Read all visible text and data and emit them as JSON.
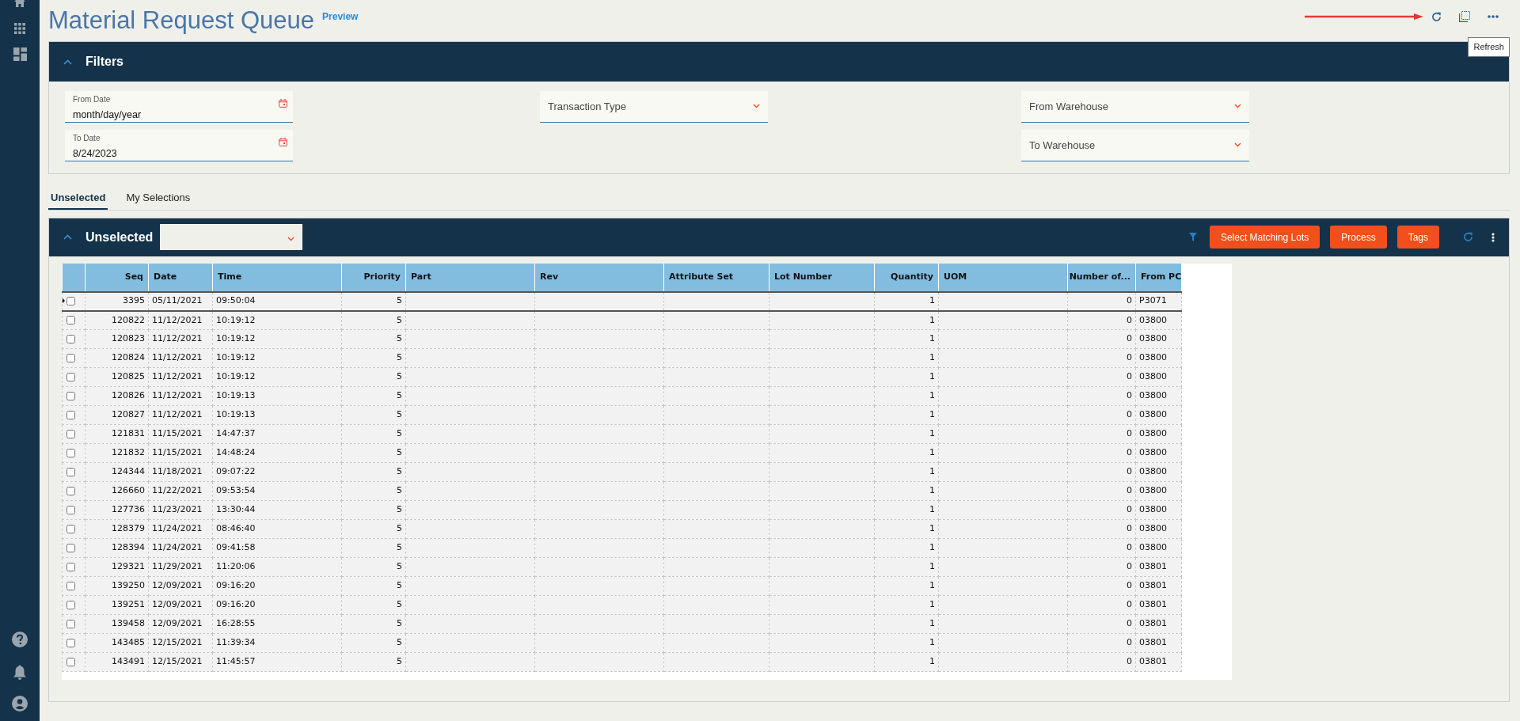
{
  "page": {
    "title": "Material Request Queue",
    "badge": "Preview"
  },
  "toolbar": {
    "tooltip": "Refresh"
  },
  "filters": {
    "title": "Filters",
    "expanded": true,
    "columns": [
      [
        {
          "kind": "date",
          "label": "From Date",
          "placeholder": "month/day/year"
        },
        {
          "kind": "date",
          "label": "To Date",
          "value": "8/24/2023"
        }
      ],
      [
        {
          "kind": "select",
          "placeholder": "Transaction Type"
        }
      ],
      [
        {
          "kind": "select",
          "placeholder": "From Warehouse"
        },
        {
          "kind": "select",
          "placeholder": "To Warehouse"
        }
      ]
    ]
  },
  "tabs": [
    {
      "label": "Unselected",
      "selected": true
    },
    {
      "label": "My Selections",
      "selected": false
    }
  ],
  "grid": {
    "title": "Unselected",
    "expanded": true,
    "buttons": [
      "Select Matching Lots",
      "Process",
      "Tags"
    ],
    "columns": [
      {
        "label": "Seq",
        "numeric": true
      },
      {
        "label": "Date",
        "numeric": false
      },
      {
        "label": "Time",
        "numeric": false
      },
      {
        "label": "Priority",
        "numeric": true
      },
      {
        "label": "Part",
        "numeric": false
      },
      {
        "label": "Rev",
        "numeric": false
      },
      {
        "label": "Attribute Set",
        "numeric": false
      },
      {
        "label": "Lot Number",
        "numeric": false
      },
      {
        "label": "Quantity",
        "numeric": true
      },
      {
        "label": "UOM",
        "numeric": false
      },
      {
        "label": "Number of...",
        "numeric": true
      },
      {
        "label": "From PC",
        "numeric": false
      }
    ],
    "rows": [
      {
        "current": true,
        "checked": false,
        "cells": [
          "3395",
          "05/11/2021",
          "09:50:04",
          "5",
          null,
          null,
          null,
          null,
          "1",
          null,
          "0",
          "P3071"
        ]
      },
      {
        "current": false,
        "checked": false,
        "cells": [
          "120822",
          "11/12/2021",
          "10:19:12",
          "5",
          null,
          null,
          null,
          null,
          "1",
          null,
          "0",
          "03800"
        ]
      },
      {
        "current": false,
        "checked": false,
        "cells": [
          "120823",
          "11/12/2021",
          "10:19:12",
          "5",
          null,
          null,
          null,
          null,
          "1",
          null,
          "0",
          "03800"
        ]
      },
      {
        "current": false,
        "checked": false,
        "cells": [
          "120824",
          "11/12/2021",
          "10:19:12",
          "5",
          null,
          null,
          null,
          null,
          "1",
          null,
          "0",
          "03800"
        ]
      },
      {
        "current": false,
        "checked": false,
        "cells": [
          "120825",
          "11/12/2021",
          "10:19:12",
          "5",
          null,
          null,
          null,
          null,
          "1",
          null,
          "0",
          "03800"
        ]
      },
      {
        "current": false,
        "checked": false,
        "cells": [
          "120826",
          "11/12/2021",
          "10:19:13",
          "5",
          null,
          null,
          null,
          null,
          "1",
          null,
          "0",
          "03800"
        ]
      },
      {
        "current": false,
        "checked": false,
        "cells": [
          "120827",
          "11/12/2021",
          "10:19:13",
          "5",
          null,
          null,
          null,
          null,
          "1",
          null,
          "0",
          "03800"
        ]
      },
      {
        "current": false,
        "checked": false,
        "cells": [
          "121831",
          "11/15/2021",
          "14:47:37",
          "5",
          null,
          null,
          null,
          null,
          "1",
          null,
          "0",
          "03800"
        ]
      },
      {
        "current": false,
        "checked": false,
        "cells": [
          "121832",
          "11/15/2021",
          "14:48:24",
          "5",
          null,
          null,
          null,
          null,
          "1",
          null,
          "0",
          "03800"
        ]
      },
      {
        "current": false,
        "checked": false,
        "cells": [
          "124344",
          "11/18/2021",
          "09:07:22",
          "5",
          null,
          null,
          null,
          null,
          "1",
          null,
          "0",
          "03800"
        ]
      },
      {
        "current": false,
        "checked": false,
        "cells": [
          "126660",
          "11/22/2021",
          "09:53:54",
          "5",
          null,
          null,
          null,
          null,
          "1",
          null,
          "0",
          "03800"
        ]
      },
      {
        "current": false,
        "checked": false,
        "cells": [
          "127736",
          "11/23/2021",
          "13:30:44",
          "5",
          null,
          null,
          null,
          null,
          "1",
          null,
          "0",
          "03800"
        ]
      },
      {
        "current": false,
        "checked": false,
        "cells": [
          "128379",
          "11/24/2021",
          "08:46:40",
          "5",
          null,
          null,
          null,
          null,
          "1",
          null,
          "0",
          "03800"
        ]
      },
      {
        "current": false,
        "checked": false,
        "cells": [
          "128394",
          "11/24/2021",
          "09:41:58",
          "5",
          null,
          null,
          null,
          null,
          "1",
          null,
          "0",
          "03800"
        ]
      },
      {
        "current": false,
        "checked": false,
        "cells": [
          "129321",
          "11/29/2021",
          "11:20:06",
          "5",
          null,
          null,
          null,
          null,
          "1",
          null,
          "0",
          "03801"
        ]
      },
      {
        "current": false,
        "checked": false,
        "cells": [
          "139250",
          "12/09/2021",
          "09:16:20",
          "5",
          null,
          null,
          null,
          null,
          "1",
          null,
          "0",
          "03801"
        ]
      },
      {
        "current": false,
        "checked": false,
        "cells": [
          "139251",
          "12/09/2021",
          "09:16:20",
          "5",
          null,
          null,
          null,
          null,
          "1",
          null,
          "0",
          "03801"
        ]
      },
      {
        "current": false,
        "checked": false,
        "cells": [
          "139458",
          "12/09/2021",
          "16:28:55",
          "5",
          null,
          null,
          null,
          null,
          "1",
          null,
          "0",
          "03801"
        ]
      },
      {
        "current": false,
        "checked": false,
        "cells": [
          "143485",
          "12/15/2021",
          "11:39:34",
          "5",
          null,
          null,
          null,
          null,
          "1",
          null,
          "0",
          "03801"
        ]
      },
      {
        "current": false,
        "checked": false,
        "cells": [
          "143491",
          "12/15/2021",
          "11:45:57",
          "5",
          null,
          null,
          null,
          null,
          "1",
          null,
          "0",
          "03801"
        ]
      }
    ]
  }
}
